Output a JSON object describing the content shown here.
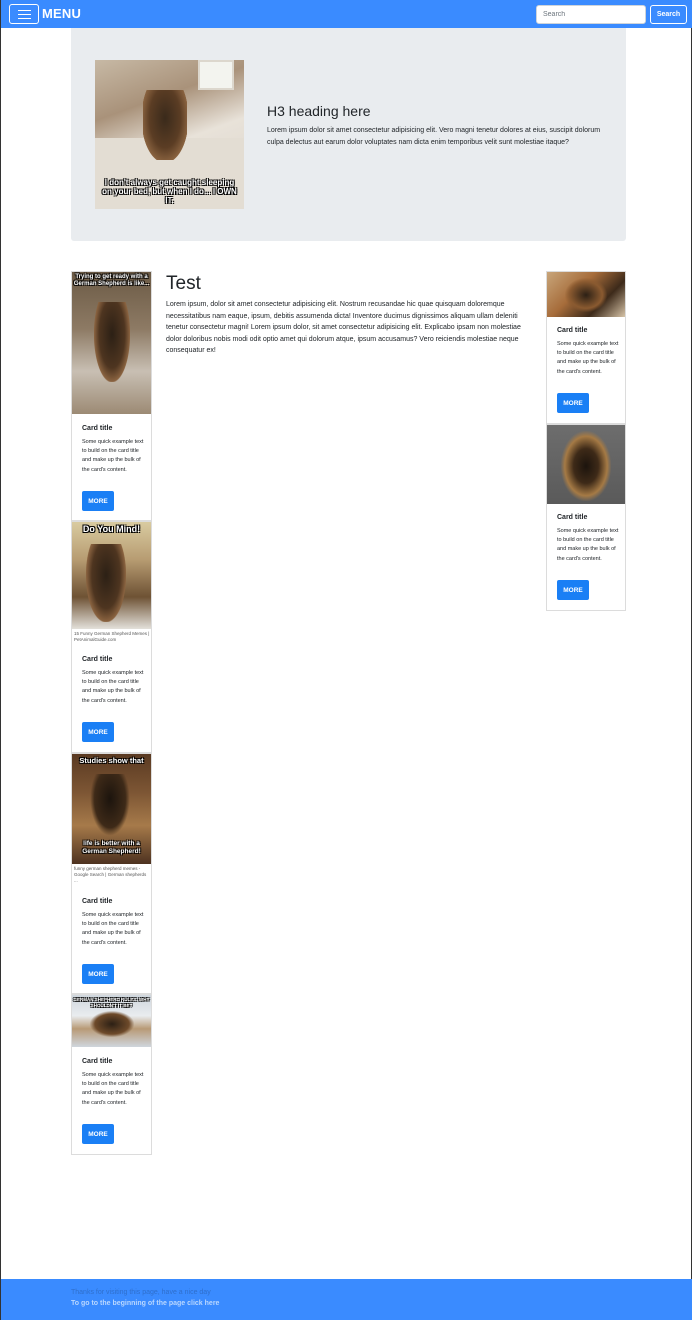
{
  "navbar": {
    "brand": "MENU",
    "search_placeholder": "Search",
    "search_button": "Search",
    "bg_color": "#3a8bff"
  },
  "jumbotron": {
    "heading": "H3 heading here",
    "text": "Lorem ipsum dolor sit amet consectetur adipisicing elit. Vero magni tenetur dolores at eius, suscipit dolorum culpa delectus aut earum dolor voluptates nam dicta enim temporibus velit sunt molestiae itaque?",
    "image_caption": "I don't always get caught sleeping on your bed, but when I do... I OWN IT."
  },
  "main": {
    "heading": "Test",
    "text": "Lorem ipsum, dolor sit amet consectetur adipisicing elit. Nostrum recusandae hic quae quisquam doloremque necessitatibus nam eaque, ipsum, debitis assumenda dicta! Inventore ducimus dignissimos aliquam ullam deleniti tenetur consectetur magni! Lorem ipsum dolor, sit amet consectetur adipisicing elit. Explicabo ipsam non molestiae dolor doloribus nobis modi odit optio amet qui dolorum atque, ipsum accusamus? Vero reiciendis molestiae neque consequatur ex!"
  },
  "left_cards": [
    {
      "image_text": "Trying to get ready with a German Shepherd is like...",
      "image_caption": "",
      "title": "Card title",
      "text": "Some quick example text to build on the card title and make up the bulk of the card's content.",
      "button": "MORE"
    },
    {
      "image_text": "Do You Mind!",
      "image_caption": "15 Funny German Shepherd Memes | PetAnimalGuide.com",
      "title": "Card title",
      "text": "Some quick example text to build on the card title and make up the bulk of the card's content.",
      "button": "MORE"
    },
    {
      "image_text": "Studies show that",
      "image_text_bottom": "life is better with a German Shepherd!",
      "image_caption": "funny german shepherd memes - Google Search | German shepherds ...",
      "title": "Card title",
      "text": "Some quick example text to build on the card title and make up the bulk of the card's content.",
      "button": "MORE"
    },
    {
      "image_text": "GERMAN SHEPHERD RULES: WHY SHOULDN'T IT BE?",
      "image_caption": "",
      "title": "Card title",
      "text": "Some quick example text to build on the card title and make up the bulk of the card's content.",
      "button": "MORE"
    }
  ],
  "right_cards": [
    {
      "title": "Card title",
      "text": "Some quick example text to build on the card title and make up the bulk of the card's content.",
      "button": "MORE"
    },
    {
      "title": "Card title",
      "text": "Some quick example text to build on the card title and make up the bulk of the card's content.",
      "button": "MORE"
    }
  ],
  "footer": {
    "thanks": "Thanks for visiting this page, have a nice day",
    "link": "To go to the beginning of the page click here"
  }
}
